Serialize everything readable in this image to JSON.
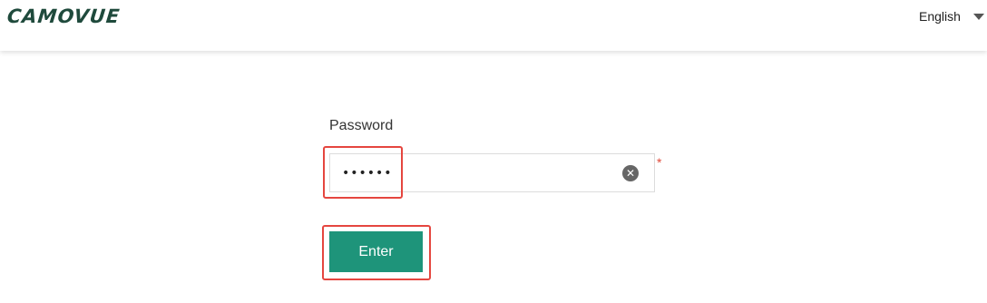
{
  "header": {
    "logo_text": "CAMOVUE",
    "language": {
      "selected": "English",
      "icon": "caret-down-icon"
    }
  },
  "form": {
    "password_label": "Password",
    "password_value": "••••••",
    "required_mark": "*",
    "clear_icon": "clear-circle-icon",
    "clear_glyph": "✕",
    "submit_label": "Enter"
  },
  "colors": {
    "brand": "#1f4a3c",
    "button": "#1e947a",
    "highlight": "#e5463f",
    "required": "#e04a3a"
  }
}
